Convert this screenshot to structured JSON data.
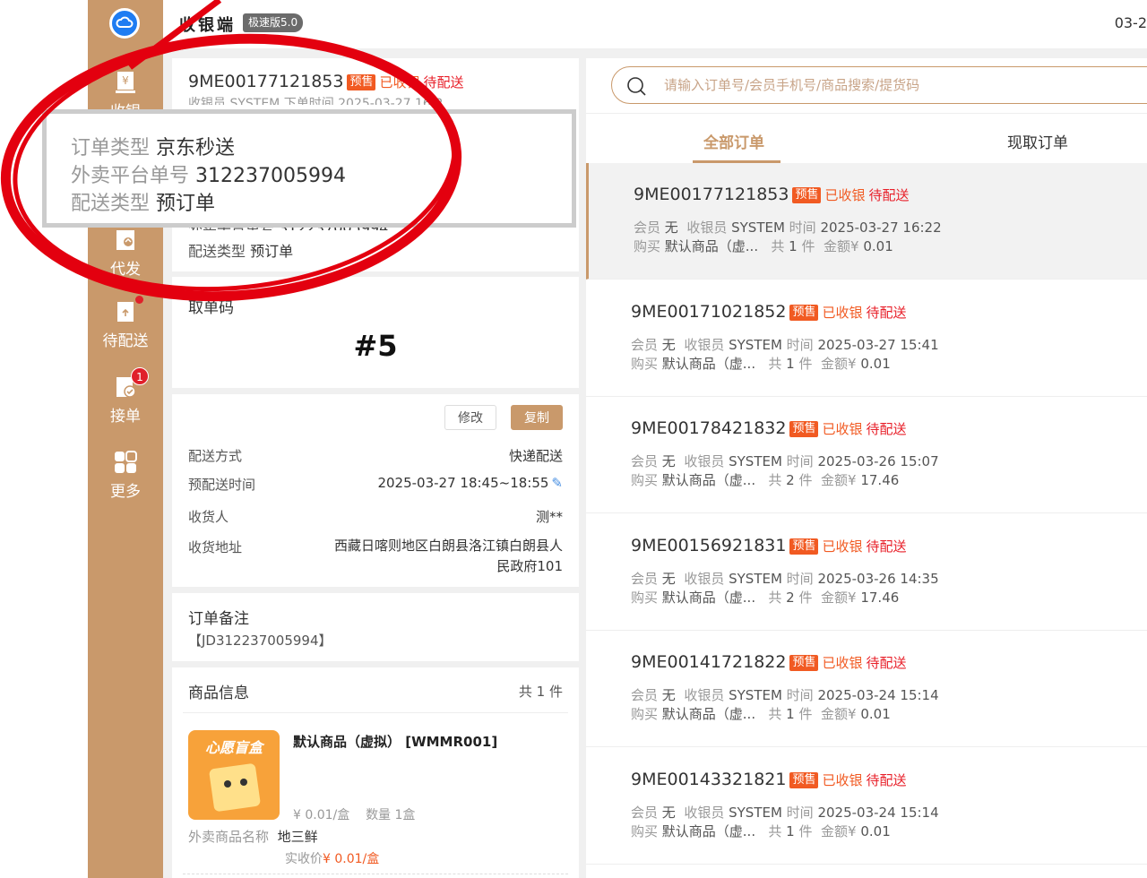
{
  "header": {
    "title": "收银端",
    "version": "极速版5.0",
    "date": "03-2"
  },
  "sidebar": {
    "items": [
      {
        "label": "收银",
        "icon": "cashier-icon"
      },
      {
        "label": "代发",
        "icon": "dispatch-icon"
      },
      {
        "label": "待配送",
        "icon": "pending-delivery-icon"
      },
      {
        "label": "接单",
        "icon": "accept-order-icon",
        "badge": "1"
      },
      {
        "label": "更多",
        "icon": "more-grid-icon"
      }
    ]
  },
  "detail": {
    "order_no": "9ME00177121853",
    "tag": "预售",
    "status_paid": "已收银",
    "status_wait": "待配送",
    "cashier_line": "收银员 SYSTEM  下单时间 2025-03-27 16:2",
    "info_lines": [
      {
        "label": "外卖平台单号",
        "value": "312237005994"
      },
      {
        "label": "配送类型",
        "value": "预订单"
      }
    ],
    "pickup_label": "取单码",
    "pickup_code": "#5",
    "edit_button": "修改",
    "copy_button": "复制",
    "delivery_rows": [
      {
        "label": "配送方式",
        "value": "快递配送"
      },
      {
        "label": "预配送时间",
        "value": "2025-03-27 18:45~18:55"
      },
      {
        "label": "收货人",
        "value": "测**"
      },
      {
        "label": "收货地址",
        "value": "西藏日喀则地区白朗县洛江镇白朗县人",
        "value2": "民政府101"
      }
    ],
    "remark_label": "订单备注",
    "remark_value": "【JD312237005994】",
    "goods_label": "商品信息",
    "goods_count": "共 1 件",
    "goods_name": "默认商品（虚拟） [WMMR001]",
    "goods_image_text": "心愿盲盒",
    "goods_price": "¥ 0.01/盒",
    "goods_qty": "数量 1盒",
    "takeout_name_label": "外卖商品名称",
    "takeout_name_value": "地三鲜",
    "actual_price_label": "实收价",
    "actual_price_value": "¥ 0.01/盒"
  },
  "zoom": {
    "lines": [
      {
        "label": "订单类型",
        "value": "京东秒送"
      },
      {
        "label": "外卖平台单号",
        "value": "312237005994"
      },
      {
        "label": "配送类型",
        "value": "预订单"
      }
    ]
  },
  "search": {
    "placeholder": "请输入订单号/会员手机号/商品搜索/提货码"
  },
  "tabs": [
    {
      "label": "全部订单",
      "active": true
    },
    {
      "label": "现取订单",
      "active": false
    }
  ],
  "orders": [
    {
      "no": "9ME00177121853",
      "tag": "预售",
      "paid": "已收银",
      "status": "待配送",
      "member": "无",
      "cashier": "SYSTEM",
      "time": "2025-03-27 16:22",
      "goods": "默认商品（虚...",
      "count": "1",
      "amount": "¥ 0.01"
    },
    {
      "no": "9ME00171021852",
      "tag": "预售",
      "paid": "已收银",
      "status": "待配送",
      "member": "无",
      "cashier": "SYSTEM",
      "time": "2025-03-27 15:41",
      "goods": "默认商品（虚...",
      "count": "1",
      "amount": "¥ 0.01"
    },
    {
      "no": "9ME00178421832",
      "tag": "预售",
      "paid": "已收银",
      "status": "待配送",
      "member": "无",
      "cashier": "SYSTEM",
      "time": "2025-03-26 15:07",
      "goods": "默认商品（虚...",
      "count": "2",
      "amount": "¥ 17.46"
    },
    {
      "no": "9ME00156921831",
      "tag": "预售",
      "paid": "已收银",
      "status": "待配送",
      "member": "无",
      "cashier": "SYSTEM",
      "time": "2025-03-26 14:35",
      "goods": "默认商品（虚...",
      "count": "2",
      "amount": "¥ 17.46"
    },
    {
      "no": "9ME00141721822",
      "tag": "预售",
      "paid": "已收银",
      "status": "待配送",
      "member": "无",
      "cashier": "SYSTEM",
      "time": "2025-03-24 15:14",
      "goods": "默认商品（虚...",
      "count": "1",
      "amount": "¥ 0.01"
    },
    {
      "no": "9ME00143321821",
      "tag": "预售",
      "paid": "已收银",
      "status": "待配送",
      "member": "无",
      "cashier": "SYSTEM",
      "time": "2025-03-24 15:14",
      "goods": "默认商品（虚...",
      "count": "1",
      "amount": "¥ 0.01"
    }
  ],
  "labels": {
    "member": "会员",
    "cashier": "收银员",
    "time": "时间",
    "buy": "购买",
    "total_prefix": "共",
    "total_suffix": "件",
    "amount": "金额"
  },
  "colors": {
    "accent": "#c9996b",
    "presale_tag": "#f15a22",
    "wait_status": "#e8202a",
    "annotation": "#e3000f"
  }
}
